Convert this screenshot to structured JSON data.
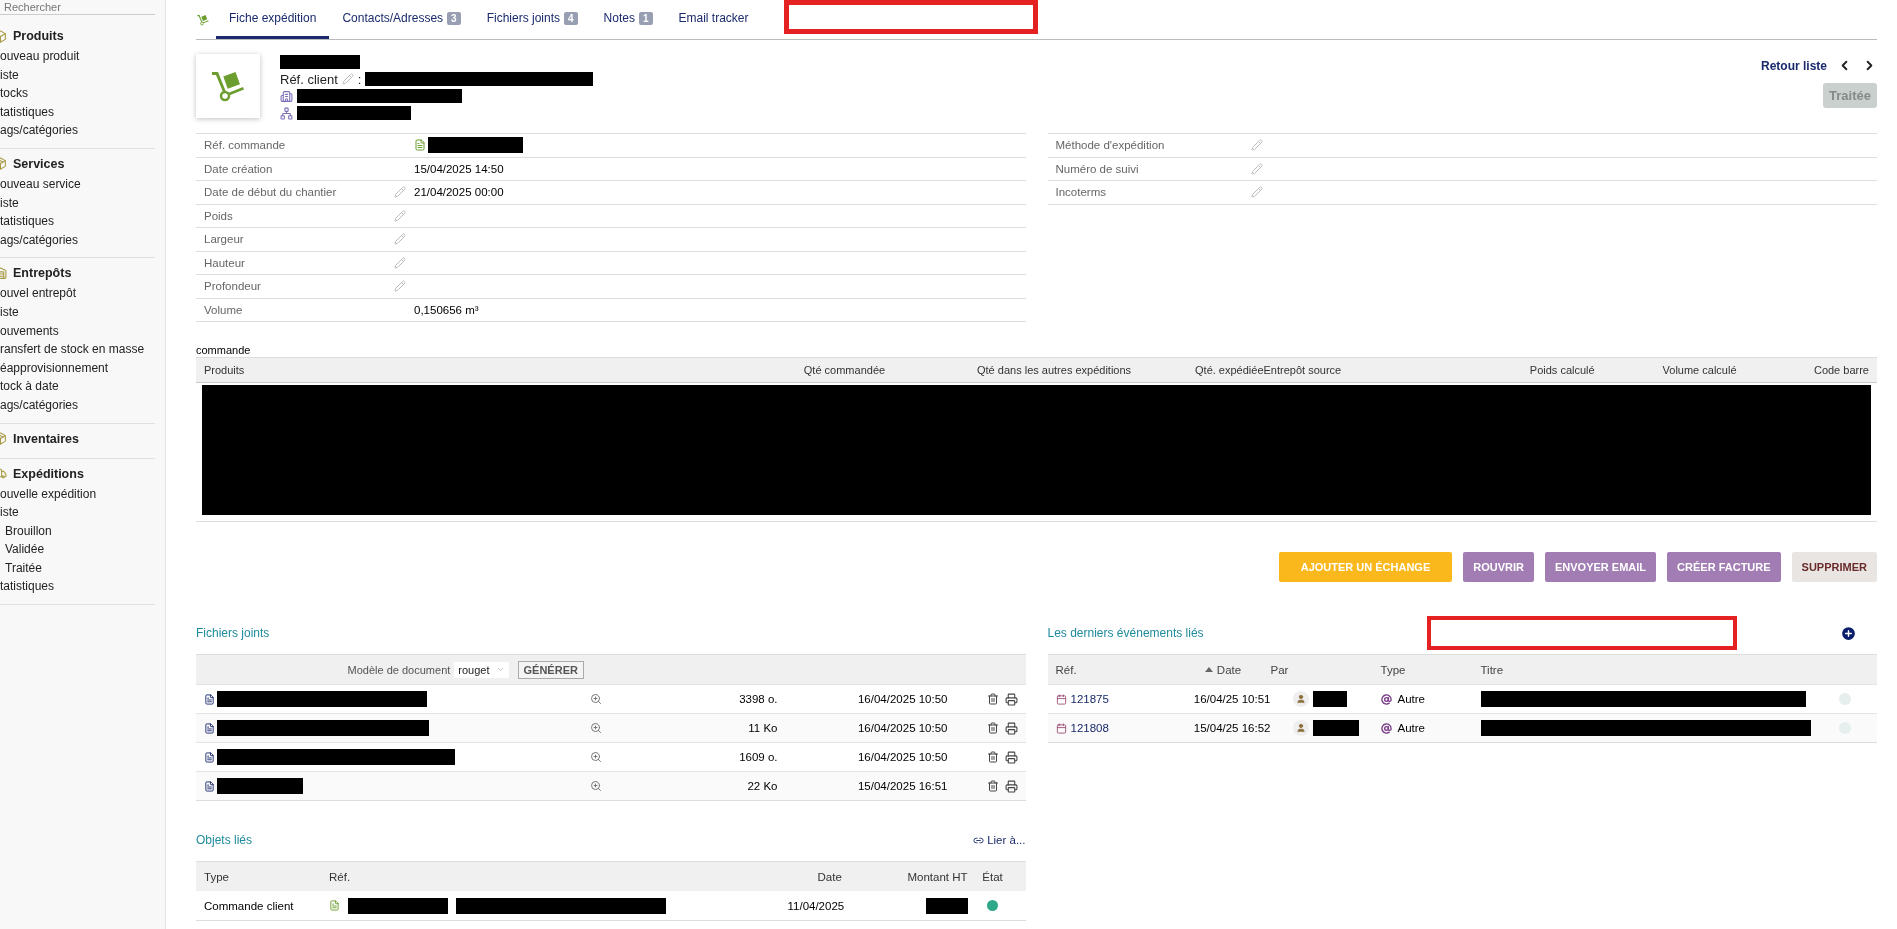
{
  "sidebar": {
    "search": {
      "placeholder": "Rechercher"
    },
    "sections": [
      {
        "title": "Produits",
        "items": [
          {
            "label": "ouveau produit"
          },
          {
            "label": "iste"
          },
          {
            "label": "tocks"
          },
          {
            "label": "tatistiques"
          },
          {
            "label": "ags/catégories"
          }
        ]
      },
      {
        "title": "Services",
        "items": [
          {
            "label": "ouveau service"
          },
          {
            "label": "iste"
          },
          {
            "label": "tatistiques"
          },
          {
            "label": "ags/catégories"
          }
        ]
      },
      {
        "title": "Entrepôts",
        "items": [
          {
            "label": "ouvel entrepôt"
          },
          {
            "label": "iste"
          },
          {
            "label": "ouvements"
          },
          {
            "label": "ransfert de stock en masse"
          },
          {
            "label": "éapprovisionnement"
          },
          {
            "label": "tock à date"
          },
          {
            "label": "ags/catégories"
          }
        ]
      },
      {
        "title": "Inventaires"
      },
      {
        "title": "Expéditions",
        "items": [
          {
            "label": "ouvelle expédition"
          },
          {
            "label": "iste",
            "children": [
              {
                "label": "Brouillon"
              },
              {
                "label": "Validée"
              },
              {
                "label": "Traitée"
              }
            ]
          },
          {
            "label": "tatistiques"
          }
        ]
      }
    ]
  },
  "tabs": [
    {
      "label": "Fiche expédition",
      "selected": true
    },
    {
      "label": "Contacts/Adresses",
      "badge": "3",
      "selected": false
    },
    {
      "label": "Fichiers joints",
      "badge": "4",
      "selected": false
    },
    {
      "label": "Notes",
      "badge": "1",
      "selected": false
    },
    {
      "label": "Email tracker",
      "selected": false
    }
  ],
  "header": {
    "ref_client_label": "Réf. client",
    "separator": ":",
    "back_link": "Retour liste",
    "status_button": {
      "label": "Traitée",
      "disabled": true
    }
  },
  "fields_left": [
    {
      "label": "Réf. commande",
      "kind": "link",
      "editable": false
    },
    {
      "label": "Date création",
      "editable": false,
      "value": "15/04/2025 14:50"
    },
    {
      "label": "Date de début du chantier",
      "editable": true,
      "value": "21/04/2025 00:00"
    },
    {
      "label": "Poids",
      "editable": true
    },
    {
      "label": "Largeur",
      "editable": true
    },
    {
      "label": "Hauteur",
      "editable": true
    },
    {
      "label": "Profondeur",
      "editable": true
    },
    {
      "label": "Volume",
      "editable": false,
      "value": "0,150656 m³"
    }
  ],
  "fields_right": [
    {
      "label": "Méthode d'expédition",
      "editable": true
    },
    {
      "label": "Numéro de suivi",
      "editable": true
    },
    {
      "label": "Incoterms",
      "editable": true
    }
  ],
  "products": {
    "title": "commande",
    "columns": [
      "Produits",
      "Qté commandée",
      "Qté dans les autres expéditions",
      "Qté. expédiée",
      "Entrepôt source",
      "Poids calculé",
      "Volume calculé",
      "Code barre"
    ]
  },
  "actions": [
    {
      "label": "AJOUTER UN ÉCHANGE",
      "kind": "warning"
    },
    {
      "label": "ROUVRIR",
      "kind": "primary"
    },
    {
      "label": "ENVOYER EMAIL",
      "kind": "primary"
    },
    {
      "label": "CRÉER FACTURE",
      "kind": "primary"
    },
    {
      "label": "SUPPRIMER",
      "kind": "delete"
    }
  ],
  "files": {
    "title": "Fichiers joints",
    "generator": {
      "label": "Modèle de document",
      "template": "rouget",
      "button": "GÉNÉRER"
    },
    "rows": [
      {
        "size": "3398 o.",
        "date": "16/04/2025 10:50"
      },
      {
        "size": "11 Ko",
        "date": "16/04/2025 10:50"
      },
      {
        "size": "1609 o.",
        "date": "16/04/2025 10:50"
      },
      {
        "size": "22 Ko",
        "date": "15/04/2025 16:51"
      }
    ]
  },
  "linked": {
    "title": "Objets liés",
    "link": "Lier à...",
    "columns": [
      "Type",
      "Réf.",
      "Date",
      "Montant HT",
      "État"
    ],
    "rows": [
      {
        "type": "Commande client",
        "date": "11/04/2025",
        "color": "#2ea889"
      }
    ]
  },
  "events": {
    "title": "Les derniers événements liés",
    "columns": [
      {
        "label": "Réf.",
        "sorted": false
      },
      {
        "label": "Date",
        "sorted": true
      },
      {
        "label": "Par",
        "sorted": false
      },
      {
        "label": "Type",
        "sorted": false
      },
      {
        "label": "Titre",
        "sorted": false
      }
    ],
    "rows": [
      {
        "ref": "121875",
        "date": "16/04/25 10:51",
        "type": "Autre"
      },
      {
        "ref": "121808",
        "date": "15/04/25 16:52",
        "type": "Autre"
      }
    ]
  }
}
